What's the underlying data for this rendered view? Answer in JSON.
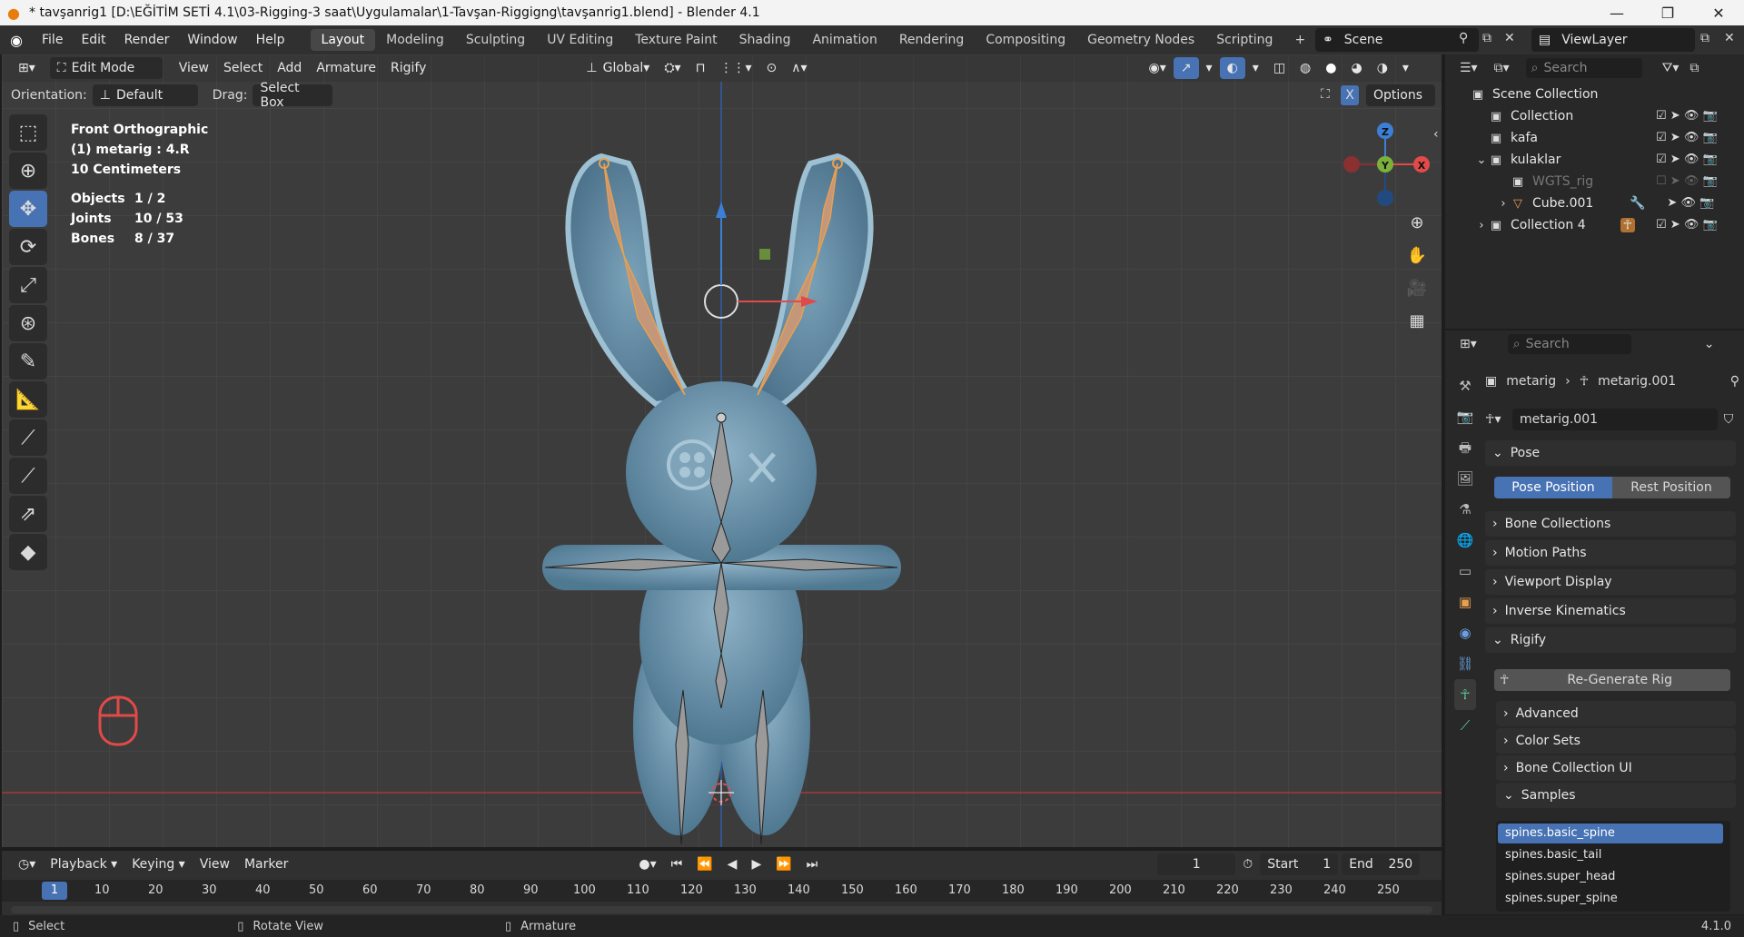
{
  "titlebar": {
    "title": "* tavşanrig1 [D:\\EĞİTİM SETİ 4.1\\03-Rigging-3 saat\\Uygulamalar\\1-Tavşan-Riggigng\\tavşanrig1.blend] - Blender 4.1"
  },
  "menu": [
    "File",
    "Edit",
    "Render",
    "Window",
    "Help"
  ],
  "workspaces": [
    "Layout",
    "Modeling",
    "Sculpting",
    "UV Editing",
    "Texture Paint",
    "Shading",
    "Animation",
    "Rendering",
    "Compositing",
    "Geometry Nodes",
    "Scripting"
  ],
  "active_workspace": "Layout",
  "scene": "Scene",
  "view_layer": "ViewLayer",
  "viewport_header": {
    "mode": "Edit Mode",
    "menus": [
      "View",
      "Select",
      "Add",
      "Armature",
      "Rigify"
    ],
    "transform": "Global"
  },
  "viewport_sub": {
    "orientation_label": "Orientation:",
    "orientation": "Default",
    "drag_label": "Drag:",
    "drag": "Select Box",
    "options": "Options",
    "x_label": "X"
  },
  "overlay": {
    "view_name": "Front Orthographic",
    "object": "(1) metarig : 4.R",
    "scale": "10 Centimeters",
    "stats": [
      {
        "label": "Objects",
        "value": "1 / 2"
      },
      {
        "label": "Joints",
        "value": "10 / 53"
      },
      {
        "label": "Bones",
        "value": "8 / 37"
      }
    ]
  },
  "gizmo": {
    "z": "Z",
    "y": "Y",
    "x": "X"
  },
  "outliner": {
    "search_placeholder": "Search",
    "scene_collection": "Scene Collection",
    "items": [
      {
        "label": "Collection"
      },
      {
        "label": "kafa"
      },
      {
        "label": "kulaklar"
      },
      {
        "label": "WGTS_rig"
      },
      {
        "label": "Cube.001"
      },
      {
        "label": "Collection 4"
      }
    ]
  },
  "properties": {
    "search_placeholder": "Search",
    "breadcrumb": [
      "metarig",
      "metarig.001"
    ],
    "datablock": "metarig.001",
    "pose_panel": "Pose",
    "pose_position": "Pose Position",
    "rest_position": "Rest Position",
    "panels": [
      "Bone Collections",
      "Motion Paths",
      "Viewport Display",
      "Inverse Kinematics"
    ],
    "rigify_panel": "Rigify",
    "regenerate": "Re-Generate Rig",
    "sub_panels": [
      "Advanced",
      "Color Sets",
      "Bone Collection UI"
    ],
    "samples_panel": "Samples",
    "samples": [
      "spines.basic_spine",
      "spines.basic_tail",
      "spines.super_head",
      "spines.super_spine"
    ]
  },
  "timeline": {
    "menus": [
      "Playback",
      "Keying",
      "View",
      "Marker"
    ],
    "current_frame": "1",
    "start_label": "Start",
    "start": "1",
    "end_label": "End",
    "end": "250",
    "ticks": [
      "1",
      "10",
      "20",
      "30",
      "40",
      "50",
      "60",
      "70",
      "80",
      "90",
      "100",
      "110",
      "120",
      "130",
      "140",
      "150",
      "160",
      "170",
      "180",
      "190",
      "200",
      "210",
      "220",
      "230",
      "240",
      "250"
    ]
  },
  "status": {
    "select": "Select",
    "rotate": "Rotate View",
    "armature": "Armature",
    "version": "4.1.0"
  },
  "colors": {
    "accent": "#4772b3",
    "model": "#6a93ab",
    "bone_select": "#e8a050",
    "x_axis": "#e24a4a",
    "y_axis": "#7bb13b",
    "z_axis": "#3b7fd6"
  }
}
